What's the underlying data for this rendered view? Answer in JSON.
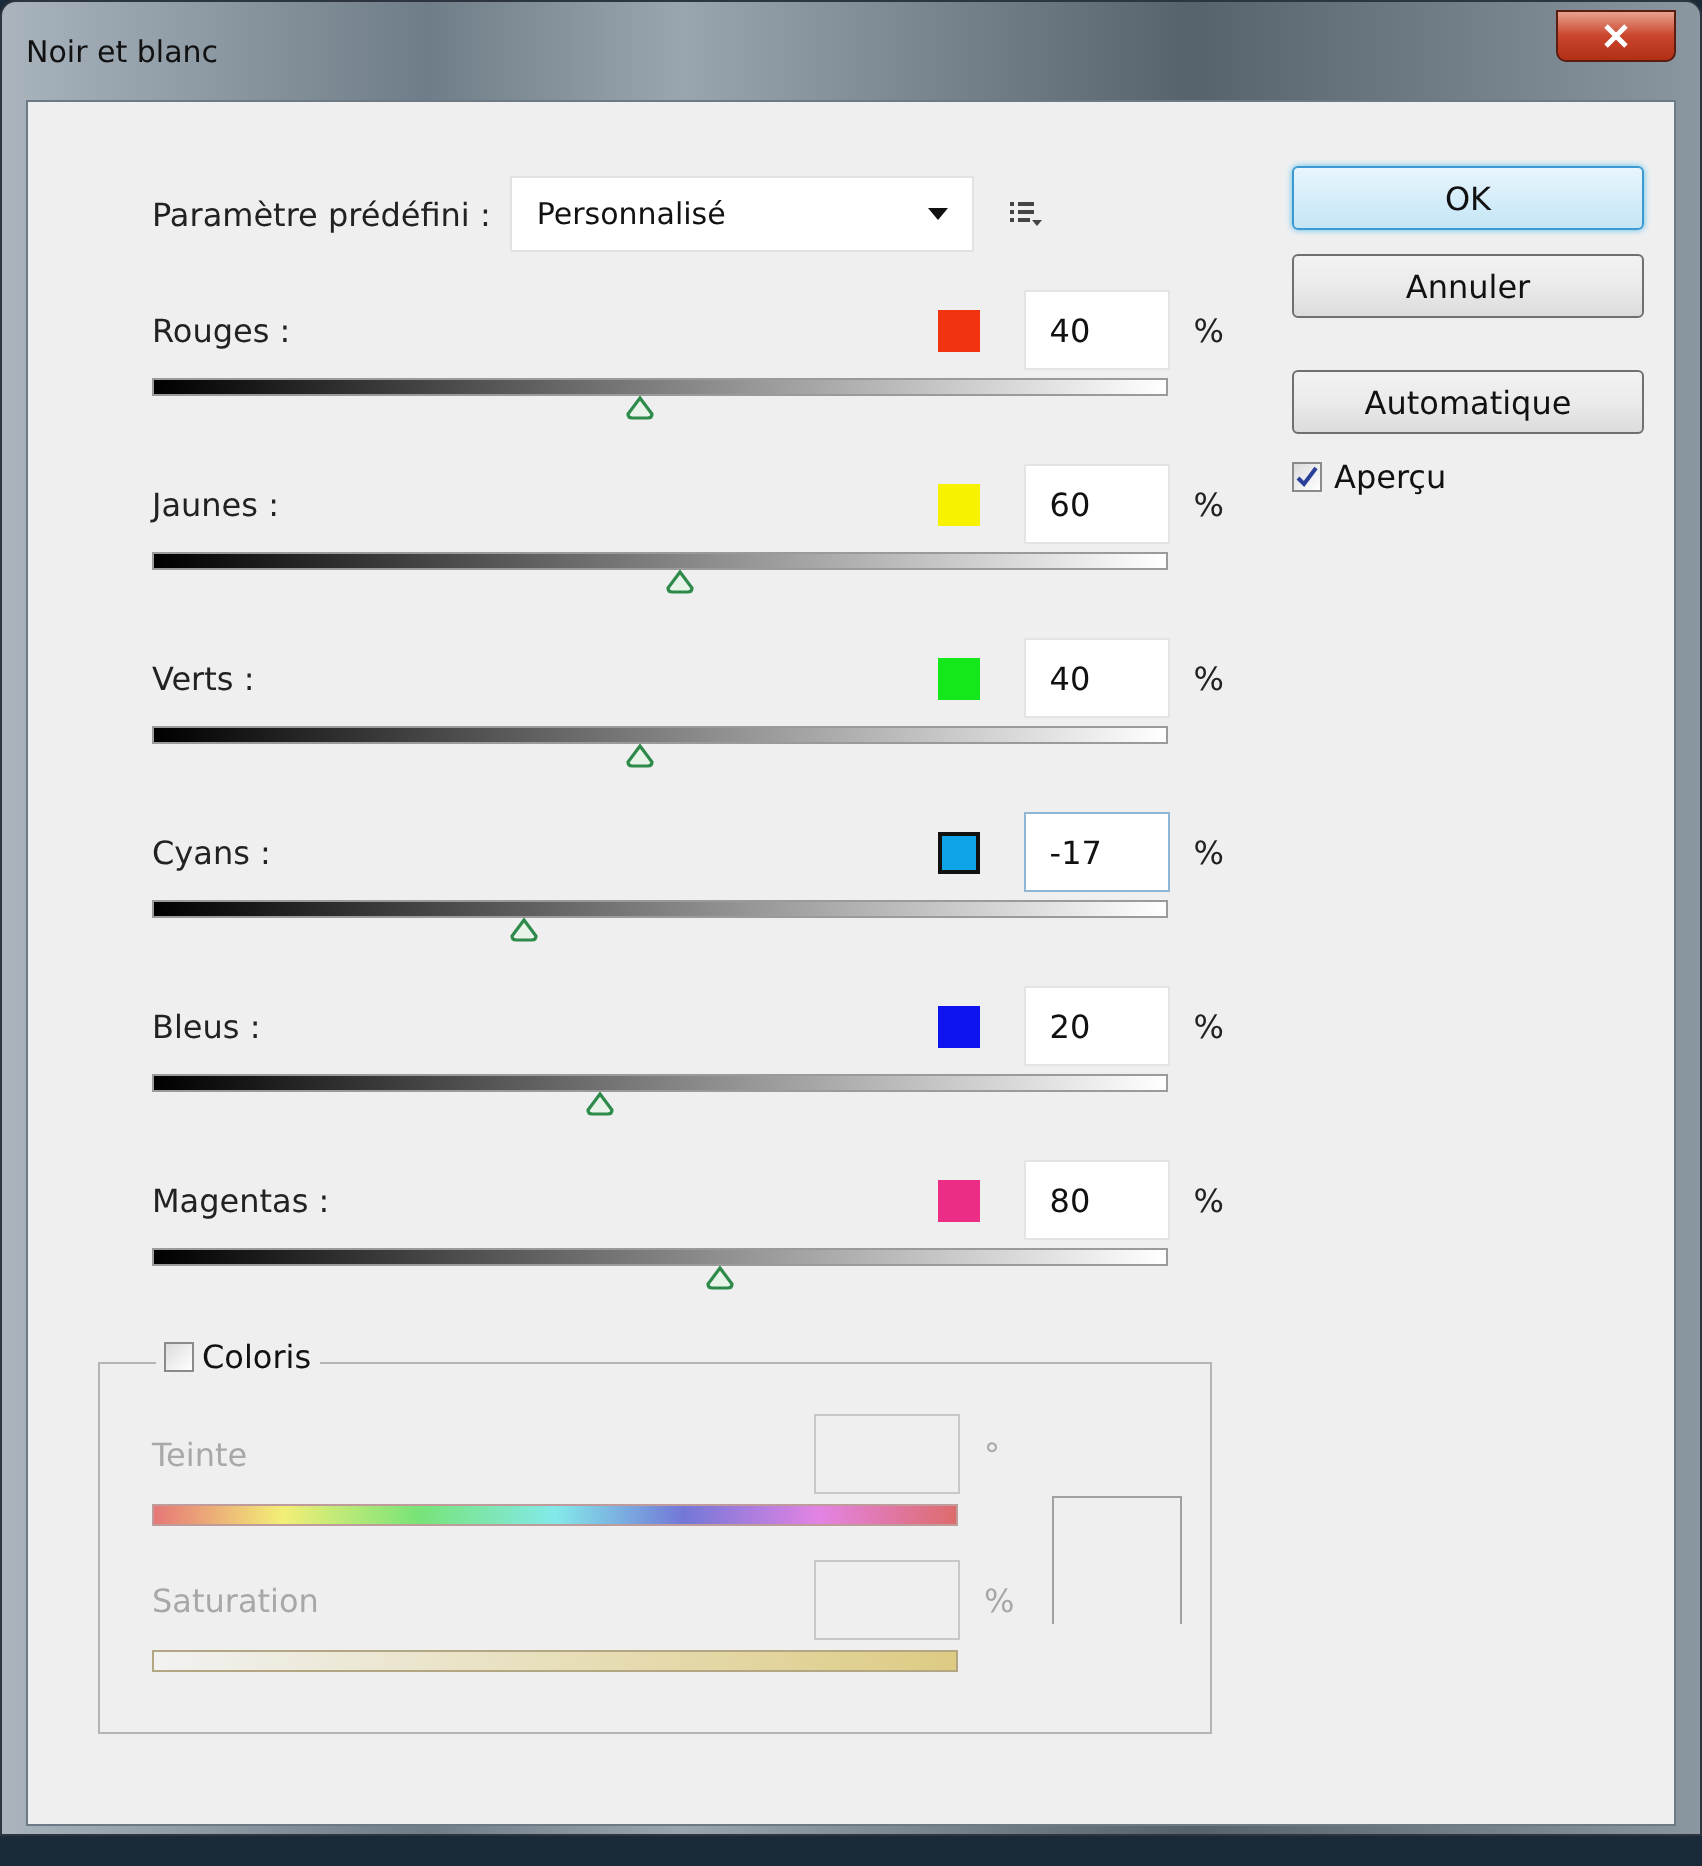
{
  "window": {
    "title": "Noir et blanc"
  },
  "preset": {
    "label": "Paramètre prédéfini :",
    "value": "Personnalisé"
  },
  "channels": [
    {
      "name": "Rouges :",
      "color": "#f2330f",
      "value": "40",
      "unit": "%",
      "level": 0.48,
      "focused": false
    },
    {
      "name": "Jaunes :",
      "color": "#f7f200",
      "value": "60",
      "unit": "%",
      "level": 0.52,
      "focused": false
    },
    {
      "name": "Verts :",
      "color": "#15e81a",
      "value": "40",
      "unit": "%",
      "level": 0.48,
      "focused": false
    },
    {
      "name": "Cyans :",
      "color": "#0fa3e8",
      "value": "-17",
      "unit": "%",
      "level": 0.366,
      "focused": true
    },
    {
      "name": "Bleus :",
      "color": "#0d14f0",
      "value": "20",
      "unit": "%",
      "level": 0.44,
      "focused": false
    },
    {
      "name": "Magentas :",
      "color": "#ec2d86",
      "value": "80",
      "unit": "%",
      "level": 0.56,
      "focused": false
    }
  ],
  "colorize": {
    "label": "Coloris",
    "checked": false,
    "hue": {
      "label": "Teinte",
      "unit": "°",
      "disabled": true
    },
    "saturation": {
      "label": "Saturation",
      "unit": "%",
      "disabled": true
    }
  },
  "buttons": [
    {
      "label": "OK",
      "default": true
    },
    {
      "label": "Annuler",
      "default": false
    },
    {
      "label": "Automatique",
      "default": false
    }
  ],
  "preview": {
    "label": "Aperçu",
    "checked": true
  }
}
